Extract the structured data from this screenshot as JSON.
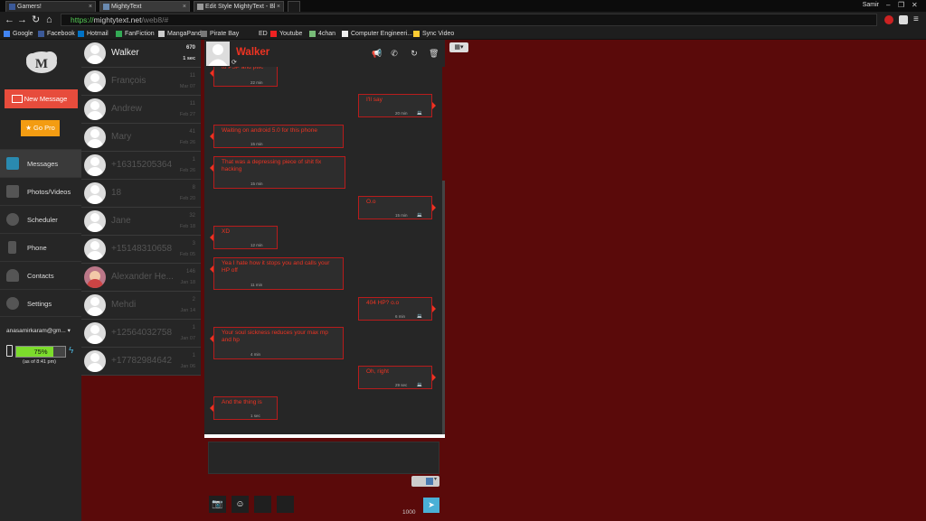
{
  "browser": {
    "tabs": [
      {
        "label": "Gamers!"
      },
      {
        "label": "MightyText"
      },
      {
        "label": "Edit Style MightyText - Bl"
      }
    ],
    "profile_name": "Samir",
    "url": {
      "scheme": "https://",
      "host": "mightytext.net",
      "path": "/web8/#"
    },
    "bookmarks": [
      "Google",
      "Facebook",
      "Hotmail",
      "FanFiction",
      "MangaPanda",
      "Pirate Bay",
      "ED",
      "Youtube",
      "4chan",
      "Computer Engineeri...",
      "Sync Video"
    ]
  },
  "sidebar": {
    "new_message_label": "New Message",
    "go_pro_label": "Go Pro",
    "nav": [
      {
        "label": "Messages"
      },
      {
        "label": "Photos/Videos"
      },
      {
        "label": "Scheduler"
      },
      {
        "label": "Phone"
      },
      {
        "label": "Contacts"
      },
      {
        "label": "Settings"
      }
    ],
    "account": "anasamirkaram@gm...",
    "battery": {
      "percent_label": "75%",
      "level": 0.75,
      "as_of": "(as of 8:41 pm)"
    }
  },
  "conversations": [
    {
      "name": "Walker",
      "count": "670",
      "time": "1 sec"
    },
    {
      "name": "François",
      "count": "11",
      "time": "Mar 07"
    },
    {
      "name": "Andrew",
      "count": "11",
      "time": "Feb 27"
    },
    {
      "name": "Mary",
      "count": "41",
      "time": "Feb 26"
    },
    {
      "name": "+16315205364",
      "count": "1",
      "time": "Feb 26"
    },
    {
      "name": "18",
      "count": "8",
      "time": "Feb 20"
    },
    {
      "name": "Jane",
      "count": "32",
      "time": "Feb 18"
    },
    {
      "name": "+15148310658",
      "count": "3",
      "time": "Feb 05"
    },
    {
      "name": "Alexander He...",
      "count": "146",
      "time": "Jan 18"
    },
    {
      "name": "Mehdi",
      "count": "2",
      "time": "Jan 14"
    },
    {
      "name": "+12564032758",
      "count": "1",
      "time": "Jan 07"
    },
    {
      "name": "+17782984642",
      "count": "1",
      "time": "Jan 06"
    }
  ],
  "chat": {
    "contact_name": "Walker",
    "messages": [
      {
        "dir": "in",
        "text": "to PSP and pwc",
        "time": "22 min"
      },
      {
        "dir": "out",
        "text": "I'll say",
        "time": "20 min"
      },
      {
        "dir": "in",
        "text": "Waiting on android 5.0 for this phone",
        "time": "15 min"
      },
      {
        "dir": "in",
        "text": "That was a depressing piece of shit fix hacking",
        "time": "15 min"
      },
      {
        "dir": "out",
        "text": "O.o",
        "time": "15 min"
      },
      {
        "dir": "in",
        "text": "XD",
        "time": "12 min"
      },
      {
        "dir": "in",
        "text": "Yea I hate how it stops you and calls your HP off",
        "time": "11 min"
      },
      {
        "dir": "out",
        "text": "404 HP? o.o",
        "time": "6 min"
      },
      {
        "dir": "in",
        "text": "Your soul sickness reduces your max mp and hp",
        "time": "4 min"
      },
      {
        "dir": "out",
        "text": "Oh, right",
        "time": "29 sec"
      },
      {
        "dir": "in",
        "text": "And the thing is",
        "time": "1 sec"
      }
    ],
    "char_count": "1000"
  }
}
